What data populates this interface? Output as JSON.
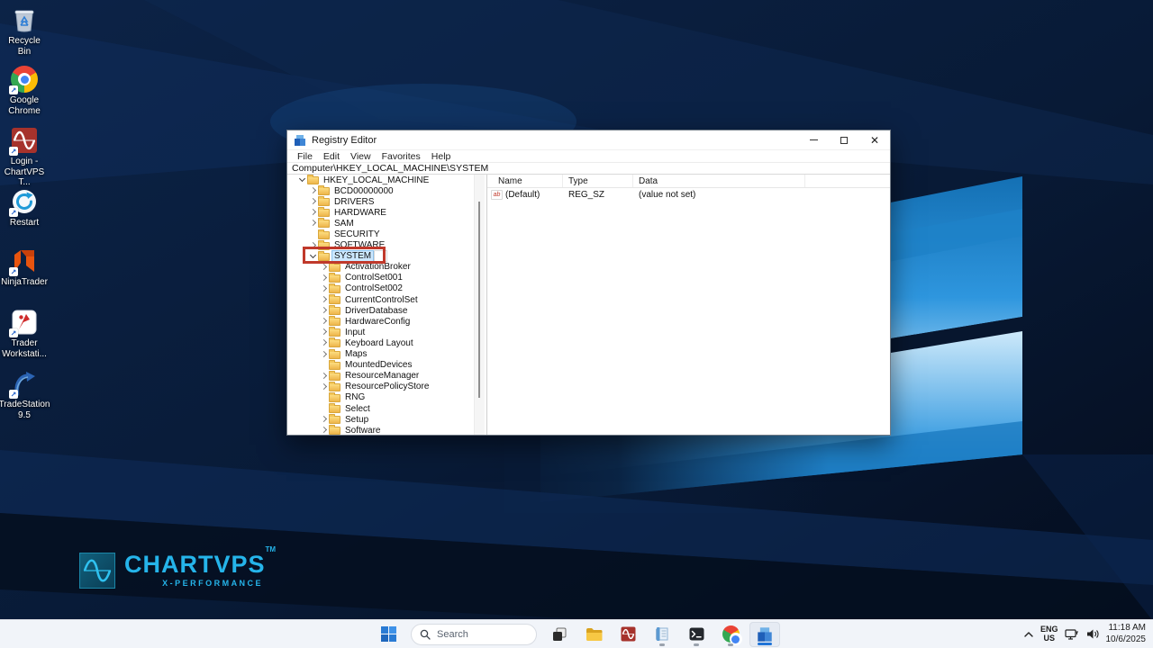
{
  "desktop": {
    "icons": [
      {
        "name": "recycle-bin",
        "line1": "Recycle Bin",
        "line2": ""
      },
      {
        "name": "google-chrome",
        "line1": "Google",
        "line2": "Chrome"
      },
      {
        "name": "login-chartvps",
        "line1": "Login -",
        "line2": "ChartVPS T..."
      },
      {
        "name": "restart",
        "line1": "Restart",
        "line2": ""
      },
      {
        "name": "ninjatrader",
        "line1": "NinjaTrader",
        "line2": ""
      },
      {
        "name": "trader-workstation",
        "line1": "Trader",
        "line2": "Workstati..."
      },
      {
        "name": "tradestation",
        "line1": "TradeStation",
        "line2": "9.5"
      }
    ],
    "logo": {
      "brand": "CHARTVPS",
      "tm": "TM",
      "tagline": "X-PERFORMANCE",
      "accent_color": "#25b4ea"
    }
  },
  "window": {
    "title": "Registry Editor",
    "menus": [
      {
        "label": "File"
      },
      {
        "label": "Edit"
      },
      {
        "label": "View"
      },
      {
        "label": "Favorites"
      },
      {
        "label": "Help"
      }
    ],
    "address": "Computer\\HKEY_LOCAL_MACHINE\\SYSTEM",
    "tree": [
      {
        "label": "HKEY_LOCAL_MACHINE",
        "depth": 1,
        "chevron": "down"
      },
      {
        "label": "BCD00000000",
        "depth": 2,
        "chevron": "right"
      },
      {
        "label": "DRIVERS",
        "depth": 2,
        "chevron": "right"
      },
      {
        "label": "HARDWARE",
        "depth": 2,
        "chevron": "right"
      },
      {
        "label": "SAM",
        "depth": 2,
        "chevron": "right"
      },
      {
        "label": "SECURITY",
        "depth": 2,
        "chevron": "none"
      },
      {
        "label": "SOFTWARE",
        "depth": 2,
        "chevron": "right"
      },
      {
        "label": "SYSTEM",
        "depth": 2,
        "chevron": "down",
        "selected": true,
        "editbox": true,
        "annotated": true
      },
      {
        "label": "ActivationBroker",
        "depth": 3,
        "chevron": "right"
      },
      {
        "label": "ControlSet001",
        "depth": 3,
        "chevron": "right"
      },
      {
        "label": "ControlSet002",
        "depth": 3,
        "chevron": "right"
      },
      {
        "label": "CurrentControlSet",
        "depth": 3,
        "chevron": "right"
      },
      {
        "label": "DriverDatabase",
        "depth": 3,
        "chevron": "right"
      },
      {
        "label": "HardwareConfig",
        "depth": 3,
        "chevron": "right"
      },
      {
        "label": "Input",
        "depth": 3,
        "chevron": "right"
      },
      {
        "label": "Keyboard Layout",
        "depth": 3,
        "chevron": "right"
      },
      {
        "label": "Maps",
        "depth": 3,
        "chevron": "right"
      },
      {
        "label": "MountedDevices",
        "depth": 3,
        "chevron": "none"
      },
      {
        "label": "ResourceManager",
        "depth": 3,
        "chevron": "right"
      },
      {
        "label": "ResourcePolicyStore",
        "depth": 3,
        "chevron": "right"
      },
      {
        "label": "RNG",
        "depth": 3,
        "chevron": "none"
      },
      {
        "label": "Select",
        "depth": 3,
        "chevron": "none"
      },
      {
        "label": "Setup",
        "depth": 3,
        "chevron": "right"
      },
      {
        "label": "Software",
        "depth": 3,
        "chevron": "right"
      },
      {
        "label": "",
        "depth": 3,
        "chevron": "right"
      }
    ],
    "annotation": {
      "color": "#c0392b"
    },
    "list": {
      "columns": [
        {
          "label": "Name"
        },
        {
          "label": "Type"
        },
        {
          "label": "Data"
        },
        {
          "label": ""
        }
      ],
      "rows": [
        {
          "name": "(Default)",
          "type": "REG_SZ",
          "data": "(value not set)",
          "icon": "reg-sz-icon",
          "icon_glyph": "ab"
        }
      ]
    }
  },
  "taskbar": {
    "search": {
      "placeholder_label": "Search"
    },
    "apps": [
      {
        "name": "task-view"
      },
      {
        "name": "file-explorer"
      },
      {
        "name": "chartvps-app"
      },
      {
        "name": "notepad",
        "running": true
      },
      {
        "name": "terminal",
        "running": true
      },
      {
        "name": "chrome",
        "running": true
      },
      {
        "name": "registry-editor",
        "active": true
      }
    ],
    "tray": {
      "language_line1": "ENG",
      "language_line2": "US",
      "time": "11:18 AM",
      "date": "10/6/2025"
    }
  }
}
